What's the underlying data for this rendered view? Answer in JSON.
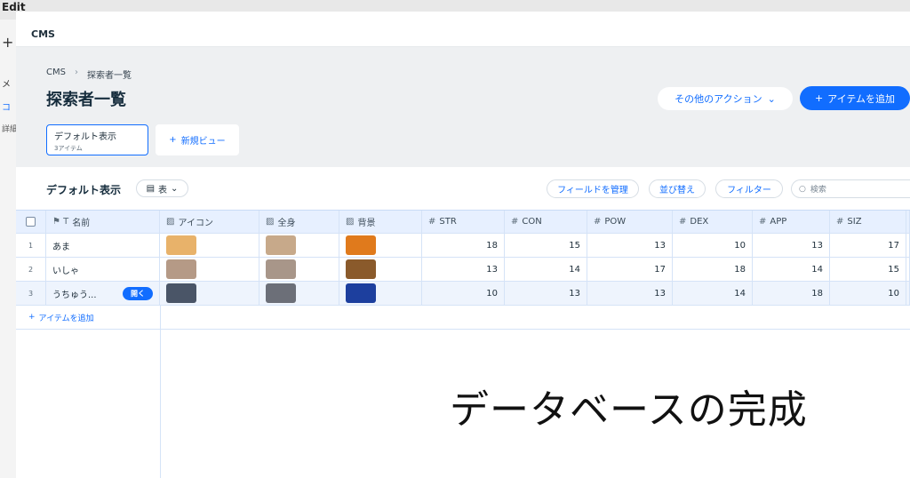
{
  "background": {
    "app_title": "Edit",
    "nav_1": "メ",
    "nav_2": "コ",
    "nav_3": "詳細"
  },
  "modal": {
    "title": "CMS"
  },
  "breadcrumb": {
    "root": "CMS",
    "current": "探索者一覧"
  },
  "page_title": "探索者一覧",
  "actions": {
    "more": "その他のアクション",
    "add_item": "アイテムを追加"
  },
  "views": {
    "default_name": "デフォルト表示",
    "default_count": "3アイテム",
    "new_view": "新規ビュー"
  },
  "toolbar": {
    "title": "デフォルト表示",
    "layout": "表",
    "manage_fields": "フィールドを管理",
    "sort": "並び替え",
    "filter": "フィルター",
    "search_placeholder": "検索"
  },
  "table": {
    "columns": [
      "名前",
      "アイコン",
      "全身",
      "背景",
      "STR",
      "CON",
      "POW",
      "DEX",
      "APP",
      "SIZ"
    ],
    "rows": [
      {
        "index": "1",
        "name": "あま",
        "STR": "18",
        "CON": "15",
        "POW": "13",
        "DEX": "10",
        "APP": "13",
        "SIZ": "17",
        "icon_color": "#e8b26a",
        "full_color": "#c7a98a",
        "bg_color": "#e07a1c"
      },
      {
        "index": "2",
        "name": "いしゃ",
        "STR": "13",
        "CON": "14",
        "POW": "17",
        "DEX": "18",
        "APP": "14",
        "SIZ": "15",
        "icon_color": "#b59a86",
        "full_color": "#a89689",
        "bg_color": "#8a5a2b"
      },
      {
        "index": "3",
        "name": "うちゅう...",
        "STR": "10",
        "CON": "13",
        "POW": "13",
        "DEX": "14",
        "APP": "18",
        "SIZ": "10",
        "icon_color": "#4a5567",
        "full_color": "#6c6f78",
        "bg_color": "#1d3f9e"
      }
    ],
    "open_label": "開く",
    "add_item": "アイテムを追加"
  },
  "caption": "データベースの完成"
}
